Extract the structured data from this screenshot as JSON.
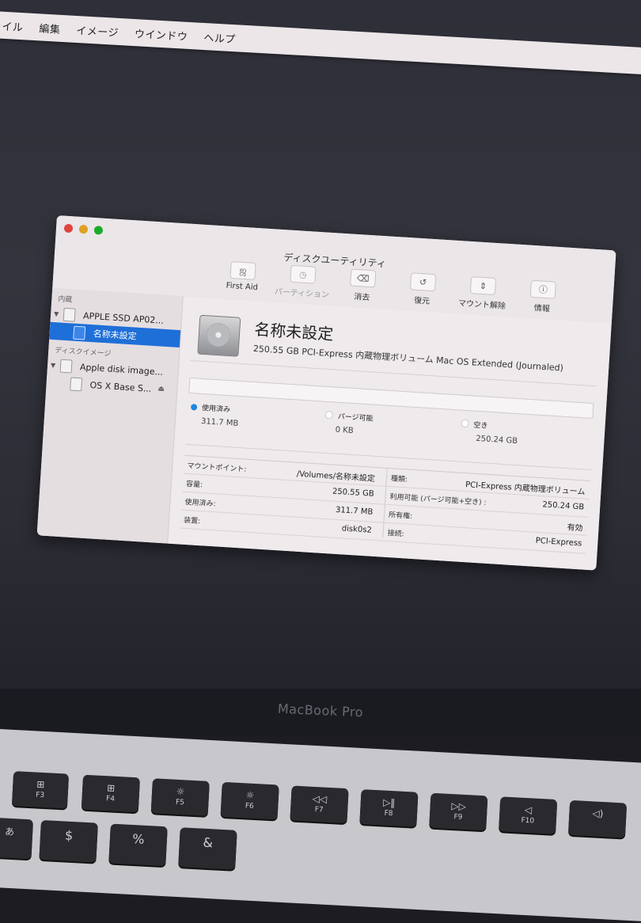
{
  "menubar": {
    "items": [
      "ァイル",
      "編集",
      "イメージ",
      "ウインドウ",
      "ヘルプ"
    ]
  },
  "window": {
    "title": "ディスクユーティリティ",
    "toolbar": [
      {
        "label": "First Aid",
        "icon": "stethoscope-icon",
        "enabled": true
      },
      {
        "label": "パーティション",
        "icon": "pie-chart-icon",
        "enabled": false
      },
      {
        "label": "消去",
        "icon": "eraser-icon",
        "enabled": true
      },
      {
        "label": "復元",
        "icon": "restore-icon",
        "enabled": true
      },
      {
        "label": "マウント解除",
        "icon": "unmount-icon",
        "enabled": true
      },
      {
        "label": "情報",
        "icon": "info-icon",
        "enabled": true
      }
    ]
  },
  "sidebar": {
    "sections": [
      {
        "title": "内蔵",
        "items": [
          {
            "label": "APPLE SSD AP02...",
            "level": 0,
            "selected": false
          },
          {
            "label": "名称未設定",
            "level": 1,
            "selected": true
          }
        ]
      },
      {
        "title": "ディスクイメージ",
        "items": [
          {
            "label": "Apple disk image...",
            "level": 0,
            "selected": false
          },
          {
            "label": "OS X Base S...",
            "level": 1,
            "selected": false,
            "eject": true
          }
        ]
      }
    ]
  },
  "volume": {
    "name": "名称未設定",
    "description": "250.55 GB PCI-Express 内蔵物理ボリューム Mac OS Extended (Journaled)",
    "usage": [
      {
        "label": "使用済み",
        "value": "311.7 MB",
        "color": "#1f86e0"
      },
      {
        "label": "パージ可能",
        "value": "0 KB",
        "color": "#ffffff"
      },
      {
        "label": "空き",
        "value": "250.24 GB",
        "color": "#ffffff"
      }
    ],
    "info_left": [
      {
        "label": "マウントポイント:",
        "value": "/Volumes/名称未設定"
      },
      {
        "label": "容量:",
        "value": "250.55 GB"
      },
      {
        "label": "使用済み:",
        "value": "311.7 MB"
      },
      {
        "label": "装置:",
        "value": "disk0s2"
      }
    ],
    "info_right": [
      {
        "label": "種類:",
        "value": "PCI-Express 内蔵物理ボリューム"
      },
      {
        "label": "利用可能 (パージ可能+空き) :",
        "value": "250.24 GB"
      },
      {
        "label": "所有権:",
        "value": "有効"
      },
      {
        "label": "接続:",
        "value": "PCI-Express"
      }
    ]
  },
  "laptop": {
    "model": "MacBook Pro"
  },
  "keys": [
    {
      "glyph": "⊞",
      "label": "F3"
    },
    {
      "glyph": "⊞",
      "label": "F4"
    },
    {
      "glyph": "☼",
      "label": "F5"
    },
    {
      "glyph": "☼",
      "label": "F6"
    },
    {
      "glyph": "◁◁",
      "label": "F7"
    },
    {
      "glyph": "▷‖",
      "label": "F8"
    },
    {
      "glyph": "▷▷",
      "label": "F9"
    },
    {
      "glyph": "◁",
      "label": "F10"
    },
    {
      "glyph": "◁)",
      "label": ""
    }
  ],
  "keys_row2": [
    "あ",
    "$",
    "%",
    "&"
  ]
}
